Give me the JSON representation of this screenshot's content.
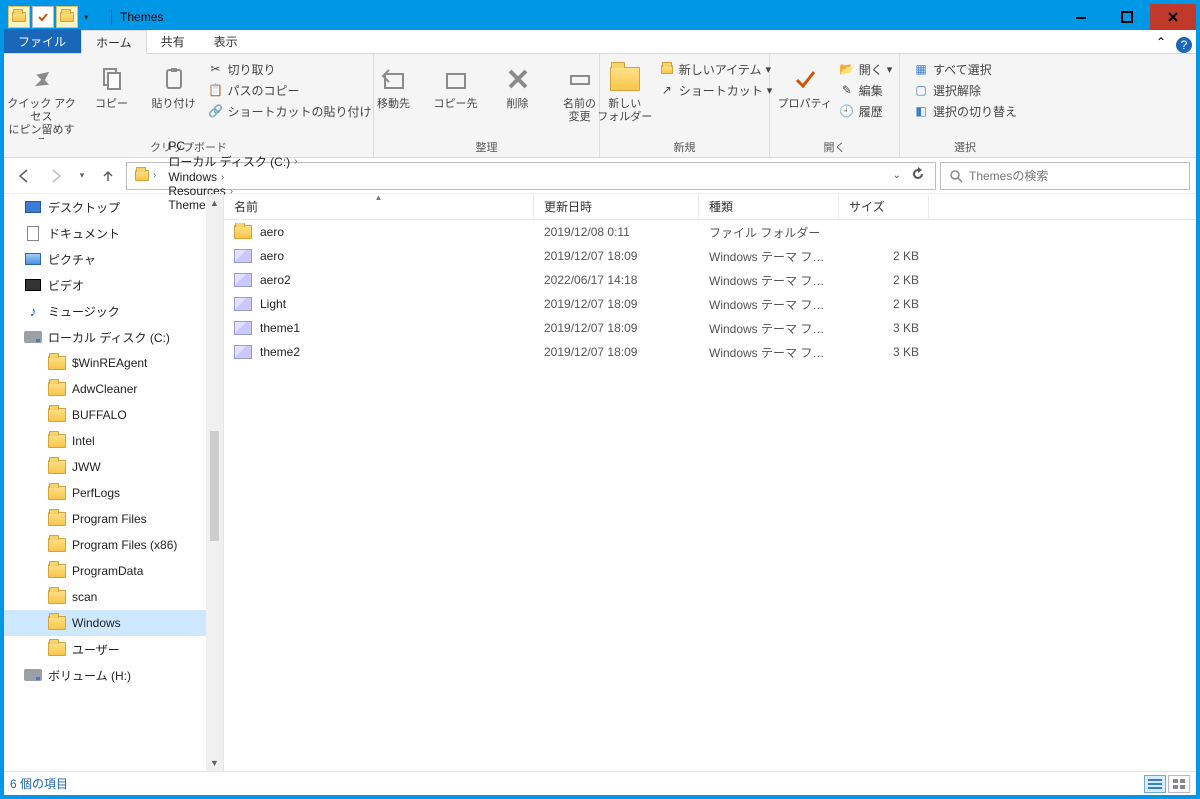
{
  "title": "Themes",
  "tabs": {
    "file": "ファイル",
    "home": "ホーム",
    "share": "共有",
    "view": "表示"
  },
  "ribbon": {
    "clipboard": {
      "label": "クリップボード",
      "pin": "クイック アクセス\nにピン留めする",
      "copy": "コピー",
      "paste": "貼り付け",
      "cut": "切り取り",
      "copypath": "パスのコピー",
      "pasteshortcut": "ショートカットの貼り付け"
    },
    "organize": {
      "label": "整理",
      "moveto": "移動先",
      "copyto": "コピー先",
      "delete": "削除",
      "rename": "名前の\n変更"
    },
    "new": {
      "label": "新規",
      "newfolder": "新しい\nフォルダー",
      "newitem": "新しいアイテム",
      "shortcut": "ショートカット"
    },
    "open": {
      "label": "開く",
      "properties": "プロパティ",
      "open": "開く",
      "edit": "編集",
      "history": "履歴"
    },
    "select": {
      "label": "選択",
      "all": "すべて選択",
      "none": "選択解除",
      "invert": "選択の切り替え"
    }
  },
  "nav": {
    "breadcrumb": [
      "PC",
      "ローカル ディスク (C:)",
      "Windows",
      "Resources",
      "Themes"
    ],
    "searchPlaceholder": "Themesの検索"
  },
  "tree": [
    {
      "icon": "desktop",
      "label": "デスクトップ"
    },
    {
      "icon": "doc",
      "label": "ドキュメント"
    },
    {
      "icon": "pic",
      "label": "ピクチャ"
    },
    {
      "icon": "vid",
      "label": "ビデオ"
    },
    {
      "icon": "music",
      "label": "ミュージック"
    },
    {
      "icon": "disk",
      "label": "ローカル ディスク (C:)"
    },
    {
      "icon": "folder",
      "label": "$WinREAgent",
      "lvl": 2
    },
    {
      "icon": "folder",
      "label": "AdwCleaner",
      "lvl": 2
    },
    {
      "icon": "folder",
      "label": "BUFFALO",
      "lvl": 2
    },
    {
      "icon": "folder",
      "label": "Intel",
      "lvl": 2
    },
    {
      "icon": "folder",
      "label": "JWW",
      "lvl": 2
    },
    {
      "icon": "folder",
      "label": "PerfLogs",
      "lvl": 2
    },
    {
      "icon": "folder",
      "label": "Program Files",
      "lvl": 2
    },
    {
      "icon": "folder",
      "label": "Program Files (x86)",
      "lvl": 2
    },
    {
      "icon": "folder",
      "label": "ProgramData",
      "lvl": 2
    },
    {
      "icon": "folder",
      "label": "scan",
      "lvl": 2
    },
    {
      "icon": "folder",
      "label": "Windows",
      "lvl": 2,
      "sel": true
    },
    {
      "icon": "folder",
      "label": "ユーザー",
      "lvl": 2
    },
    {
      "icon": "disk",
      "label": "ボリューム (H:)"
    }
  ],
  "columns": {
    "name": "名前",
    "date": "更新日時",
    "type": "種類",
    "size": "サイズ"
  },
  "rows": [
    {
      "icon": "folder",
      "name": "aero",
      "date": "2019/12/08 0:11",
      "type": "ファイル フォルダー",
      "size": ""
    },
    {
      "icon": "theme",
      "name": "aero",
      "date": "2019/12/07 18:09",
      "type": "Windows テーマ ファ...",
      "size": "2 KB"
    },
    {
      "icon": "theme",
      "name": "aero2",
      "date": "2022/06/17 14:18",
      "type": "Windows テーマ ファ...",
      "size": "2 KB"
    },
    {
      "icon": "theme",
      "name": "Light",
      "date": "2019/12/07 18:09",
      "type": "Windows テーマ ファ...",
      "size": "2 KB"
    },
    {
      "icon": "theme",
      "name": "theme1",
      "date": "2019/12/07 18:09",
      "type": "Windows テーマ ファ...",
      "size": "3 KB"
    },
    {
      "icon": "theme",
      "name": "theme2",
      "date": "2019/12/07 18:09",
      "type": "Windows テーマ ファ...",
      "size": "3 KB"
    }
  ],
  "status": "6 個の項目"
}
